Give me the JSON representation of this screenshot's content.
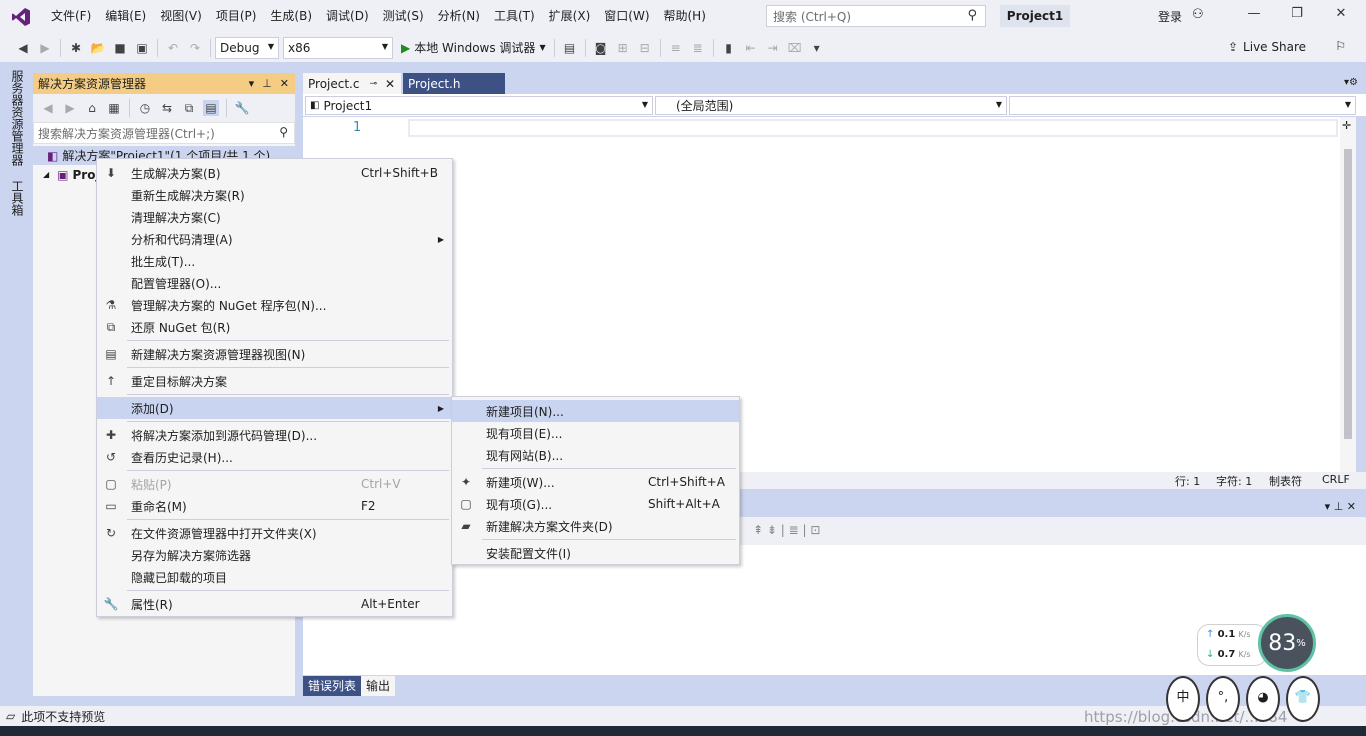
{
  "menubar": {
    "items": [
      "文件(F)",
      "编辑(E)",
      "视图(V)",
      "项目(P)",
      "生成(B)",
      "调试(D)",
      "测试(S)",
      "分析(N)",
      "工具(T)",
      "扩展(X)",
      "窗口(W)",
      "帮助(H)"
    ],
    "search_placeholder": "搜索 (Ctrl+Q)",
    "project_name": "Project1",
    "login": "登录"
  },
  "toolbar": {
    "config": "Debug",
    "platform": "x86",
    "run_label": "本地 Windows 调试器",
    "live_share": "Live Share"
  },
  "left_strip": {
    "server_explorer": "服务器资源管理器",
    "toolbox": "工具箱"
  },
  "solution_explorer": {
    "title": "解决方案资源管理器",
    "search_placeholder": "搜索解决方案资源管理器(Ctrl+;)",
    "root": "解决方案\"Project1\"(1 个项目/共 1 个)",
    "project": "Project1"
  },
  "editor": {
    "tabs": [
      "Project.c",
      "Project.h"
    ],
    "nav_project": "Project1",
    "nav_scope": "(全局范围)",
    "line_number": "1",
    "status": {
      "line": "行: 1",
      "char": "字符: 1",
      "tab": "制表符",
      "eol": "CRLF"
    }
  },
  "bottom_tabs": [
    "错误列表",
    "输出"
  ],
  "statusbar": {
    "text": "此项不支持预览"
  },
  "watermark": "https://blog.csdn.net/...784",
  "context_menu": {
    "items": [
      {
        "label": "生成解决方案(B)",
        "shortcut": "Ctrl+Shift+B",
        "icon": "build-icon"
      },
      {
        "label": "重新生成解决方案(R)",
        "shortcut": "",
        "icon": ""
      },
      {
        "label": "清理解决方案(C)",
        "shortcut": "",
        "icon": ""
      },
      {
        "label": "分析和代码清理(A)",
        "shortcut": "",
        "icon": "",
        "submenu": true
      },
      {
        "label": "批生成(T)...",
        "shortcut": "",
        "icon": ""
      },
      {
        "label": "配置管理器(O)...",
        "shortcut": "",
        "icon": ""
      },
      {
        "label": "管理解决方案的 NuGet 程序包(N)...",
        "shortcut": "",
        "icon": "nuget-icon"
      },
      {
        "label": "还原 NuGet 包(R)",
        "shortcut": "",
        "icon": "restore-icon"
      },
      {
        "separator": true
      },
      {
        "label": "新建解决方案资源管理器视图(N)",
        "shortcut": "",
        "icon": "new-view-icon"
      },
      {
        "separator": true
      },
      {
        "label": "重定目标解决方案",
        "shortcut": "",
        "icon": "retarget-icon"
      },
      {
        "separator": true
      },
      {
        "label": "添加(D)",
        "shortcut": "",
        "icon": "",
        "submenu": true,
        "highlight": true
      },
      {
        "separator": true
      },
      {
        "label": "将解决方案添加到源代码管理(D)...",
        "shortcut": "",
        "icon": "source-control-icon"
      },
      {
        "label": "查看历史记录(H)...",
        "shortcut": "",
        "icon": "history-icon"
      },
      {
        "separator": true
      },
      {
        "label": "粘贴(P)",
        "shortcut": "Ctrl+V",
        "icon": "paste-icon",
        "disabled": true
      },
      {
        "label": "重命名(M)",
        "shortcut": "F2",
        "icon": "rename-icon"
      },
      {
        "separator": true
      },
      {
        "label": "在文件资源管理器中打开文件夹(X)",
        "shortcut": "",
        "icon": "open-folder-icon"
      },
      {
        "label": "另存为解决方案筛选器",
        "shortcut": "",
        "icon": ""
      },
      {
        "label": "隐藏已卸载的项目",
        "shortcut": "",
        "icon": ""
      },
      {
        "separator": true
      },
      {
        "label": "属性(R)",
        "shortcut": "Alt+Enter",
        "icon": "wrench-icon"
      }
    ]
  },
  "submenu": {
    "items": [
      {
        "label": "新建项目(N)...",
        "shortcut": "",
        "icon": "",
        "highlight": true
      },
      {
        "label": "现有项目(E)...",
        "shortcut": "",
        "icon": ""
      },
      {
        "label": "现有网站(B)...",
        "shortcut": "",
        "icon": ""
      },
      {
        "separator": true
      },
      {
        "label": "新建项(W)...",
        "shortcut": "Ctrl+Shift+A",
        "icon": "new-item-icon"
      },
      {
        "label": "现有项(G)...",
        "shortcut": "Shift+Alt+A",
        "icon": "existing-item-icon"
      },
      {
        "label": "新建解决方案文件夹(D)",
        "shortcut": "",
        "icon": "folder-icon"
      },
      {
        "separator": true
      },
      {
        "label": "安装配置文件(I)",
        "shortcut": "",
        "icon": ""
      }
    ]
  },
  "net_widget": {
    "up": "0.1",
    "down": "0.7",
    "unit": "K/s",
    "percent": "83",
    "percent_sign": "%"
  },
  "faces": [
    "中",
    "°,",
    "◕",
    "👕"
  ]
}
